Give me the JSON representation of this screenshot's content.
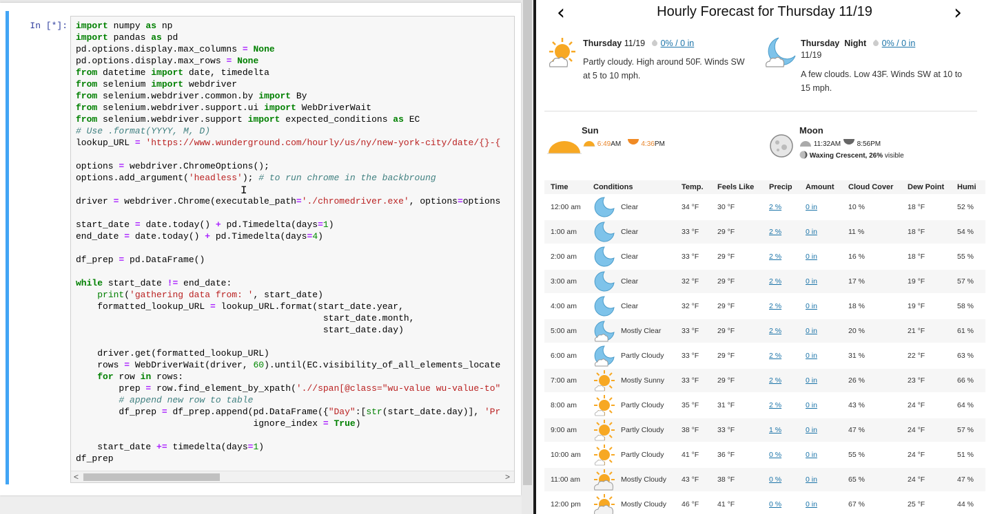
{
  "notebook": {
    "prompt": "In [*]:",
    "code_lines": [
      "import numpy as np",
      "import pandas as pd",
      "pd.options.display.max_columns = None",
      "pd.options.display.max_rows = None",
      "from datetime import date, timedelta",
      "from selenium import webdriver",
      "from selenium.webdriver.common.by import By",
      "from selenium.webdriver.support.ui import WebDriverWait",
      "from selenium.webdriver.support import expected_conditions as EC",
      "# Use .format(YYYY, M, D)",
      "lookup_URL = 'https://www.wunderground.com/hourly/us/ny/new-york-city/date/{}-{",
      "",
      "options = webdriver.ChromeOptions();",
      "options.add_argument('headless'); # to run chrome in the backbroung",
      "",
      "driver = webdriver.Chrome(executable_path='./chromedriver.exe', options=options",
      "",
      "start_date = date.today() + pd.Timedelta(days=1)",
      "end_date = date.today() + pd.Timedelta(days=4)",
      "",
      "df_prep = pd.DataFrame()",
      "",
      "while start_date != end_date:",
      "    print('gathering data from: ', start_date)",
      "    formatted_lookup_URL = lookup_URL.format(start_date.year,",
      "                                              start_date.month,",
      "                                              start_date.day)",
      "",
      "    driver.get(formatted_lookup_URL)",
      "    rows = WebDriverWait(driver, 60).until(EC.visibility_of_all_elements_locate",
      "    for row in rows:",
      "        prep = row.find_element_by_xpath('.//span[@class=\"wu-value wu-value-to\"",
      "        # append new row to table",
      "        df_prep = df_prep.append(pd.DataFrame({\"Day\":[str(start_date.day)], 'Pr",
      "                                 ignore_index = True)",
      "",
      "    start_date += timedelta(days=1)",
      "df_prep"
    ],
    "scroll_left": "<",
    "scroll_right": ">"
  },
  "weather": {
    "title": "Hourly Forecast for Thursday 11/19",
    "prev_arrow": "‹",
    "next_arrow": "›",
    "day": {
      "name": "Thursday",
      "date": "11/19",
      "precip": "0% / 0 in",
      "desc_line1": "Partly cloudy. High around 50F. Winds SW",
      "desc_line2": "at 5 to 10 mph."
    },
    "night": {
      "name": "Thursday",
      "label": "Night",
      "date": "11/19",
      "precip": "0% / 0 in",
      "desc_line1": "A few clouds. Low 43F. Winds SW at 10 to",
      "desc_line2": "15 mph."
    },
    "sun": {
      "label": "Sun",
      "rise": "6:49",
      "rise_ampm": "AM",
      "set": "4:36",
      "set_ampm": "PM"
    },
    "moon": {
      "label": "Moon",
      "rise": "11:32AM",
      "set": "8:56PM",
      "phase": "Waxing Crescent, 26%",
      "phase_suffix": "visible"
    },
    "columns": [
      "Time",
      "Conditions",
      "Temp.",
      "Feels Like",
      "Precip",
      "Amount",
      "Cloud Cover",
      "Dew Point",
      "Humi"
    ],
    "rows": [
      {
        "time": "12:00 am",
        "icon": "moon-icon",
        "cond": "Clear",
        "temp": "34 °F",
        "feels": "30 °F",
        "precip": "2 %",
        "amount": "0 in",
        "cloud": "10 %",
        "dew": "18 °F",
        "hum": "52 %"
      },
      {
        "time": "1:00 am",
        "icon": "moon-icon",
        "cond": "Clear",
        "temp": "33 °F",
        "feels": "29 °F",
        "precip": "2 %",
        "amount": "0 in",
        "cloud": "11 %",
        "dew": "18 °F",
        "hum": "54 %"
      },
      {
        "time": "2:00 am",
        "icon": "moon-icon",
        "cond": "Clear",
        "temp": "33 °F",
        "feels": "29 °F",
        "precip": "2 %",
        "amount": "0 in",
        "cloud": "16 %",
        "dew": "18 °F",
        "hum": "55 %"
      },
      {
        "time": "3:00 am",
        "icon": "moon-icon",
        "cond": "Clear",
        "temp": "32 °F",
        "feels": "29 °F",
        "precip": "2 %",
        "amount": "0 in",
        "cloud": "17 %",
        "dew": "19 °F",
        "hum": "57 %"
      },
      {
        "time": "4:00 am",
        "icon": "moon-icon",
        "cond": "Clear",
        "temp": "32 °F",
        "feels": "29 °F",
        "precip": "2 %",
        "amount": "0 in",
        "cloud": "18 %",
        "dew": "19 °F",
        "hum": "58 %"
      },
      {
        "time": "5:00 am",
        "icon": "moon-cloud-icon",
        "cond": "Mostly Clear",
        "temp": "33 °F",
        "feels": "29 °F",
        "precip": "2 %",
        "amount": "0 in",
        "cloud": "20 %",
        "dew": "21 °F",
        "hum": "61 %"
      },
      {
        "time": "6:00 am",
        "icon": "moon-cloud-icon",
        "cond": "Partly Cloudy",
        "temp": "33 °F",
        "feels": "29 °F",
        "precip": "2 %",
        "amount": "0 in",
        "cloud": "31 %",
        "dew": "22 °F",
        "hum": "63 %"
      },
      {
        "time": "7:00 am",
        "icon": "sun-icon",
        "cond": "Mostly Sunny",
        "temp": "33 °F",
        "feels": "29 °F",
        "precip": "2 %",
        "amount": "0 in",
        "cloud": "26 %",
        "dew": "23 °F",
        "hum": "66 %"
      },
      {
        "time": "8:00 am",
        "icon": "sun-icon",
        "cond": "Partly Cloudy",
        "temp": "35 °F",
        "feels": "31 °F",
        "precip": "2 %",
        "amount": "0 in",
        "cloud": "43 %",
        "dew": "24 °F",
        "hum": "64 %"
      },
      {
        "time": "9:00 am",
        "icon": "sun-icon",
        "cond": "Partly Cloudy",
        "temp": "38 °F",
        "feels": "33 °F",
        "precip": "1 %",
        "amount": "0 in",
        "cloud": "47 %",
        "dew": "24 °F",
        "hum": "57 %"
      },
      {
        "time": "10:00 am",
        "icon": "sun-icon",
        "cond": "Partly Cloudy",
        "temp": "41 °F",
        "feels": "36 °F",
        "precip": "0 %",
        "amount": "0 in",
        "cloud": "55 %",
        "dew": "24 °F",
        "hum": "51 %"
      },
      {
        "time": "11:00 am",
        "icon": "sun-cloud-icon",
        "cond": "Mostly Cloudy",
        "temp": "43 °F",
        "feels": "38 °F",
        "precip": "0 %",
        "amount": "0 in",
        "cloud": "65 %",
        "dew": "24 °F",
        "hum": "47 %"
      },
      {
        "time": "12:00 pm",
        "icon": "sun-cloud-icon",
        "cond": "Mostly Cloudy",
        "temp": "46 °F",
        "feels": "41 °F",
        "precip": "0 %",
        "amount": "0 in",
        "cloud": "67 %",
        "dew": "25 °F",
        "hum": "44 %"
      }
    ],
    "colors": {
      "link": "#1a73a8",
      "moon": "#7ec3ea",
      "sun": "#f7a823",
      "sunrise_text": "#e8852b"
    }
  }
}
